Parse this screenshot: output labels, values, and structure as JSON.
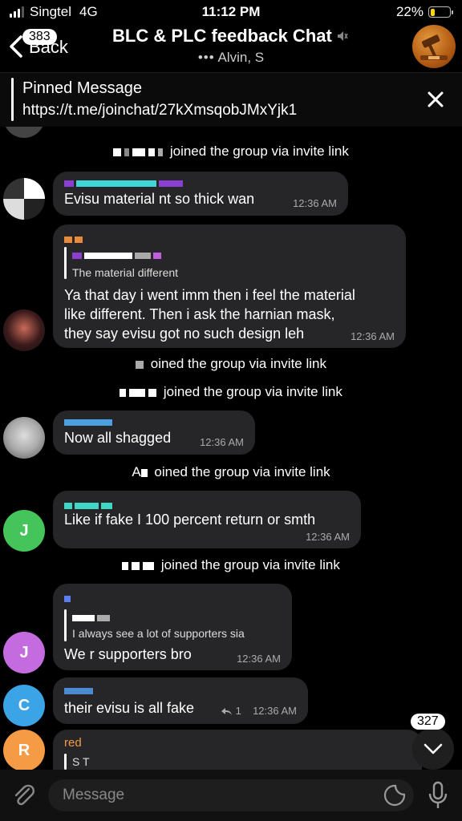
{
  "status_bar": {
    "carrier": "Singtel",
    "network": "4G",
    "time": "11:12 PM",
    "battery_percent": "22%",
    "battery_level": 0.22
  },
  "header": {
    "back_label": "Back",
    "back_count": "383",
    "title": "BLC & PLC feedback Chat",
    "subtitle": "Alvin, S",
    "muted": true
  },
  "pinned": {
    "title": "Pinned Message",
    "link": "https://t.me/joinchat/27kXmsqobJMxYjk1"
  },
  "messages": {
    "service1": "joined the group via invite link",
    "m1": {
      "text": "Evisu material nt so thick wan",
      "time": "12:36 AM"
    },
    "m2": {
      "quote": "The material different",
      "text1": "Ya that day i went imm then i feel the material",
      "text2": "like different. Then i ask the harnian mask,",
      "text3": "they say evisu got no such design leh",
      "time": "12:36 AM"
    },
    "service2": "oined the group via invite link",
    "service3": "joined the group via invite link",
    "m3": {
      "text": "Now all shagged",
      "time": "12:36 AM"
    },
    "service4_prefix": "A",
    "service4": "oined the group via invite link",
    "m4": {
      "text": "Like if fake I 100 percent return or smth",
      "time": "12:36 AM",
      "avatar_letter": "J",
      "avatar_color": "#45c45a"
    },
    "service5": "joined the group via invite link",
    "m5": {
      "quote": "I always see a lot of supporters sia",
      "text": "We r supporters bro",
      "time": "12:36 AM",
      "avatar_letter": "J",
      "avatar_color": "#c56be0"
    },
    "m6": {
      "text": "their evisu is all fake",
      "replies": "1",
      "time": "12:36 AM",
      "avatar_letter": "C",
      "avatar_color": "#3aa4e6"
    },
    "m7": {
      "name": "red",
      "quote": "S T",
      "avatar_letter": "R",
      "avatar_color": "#f59a45"
    }
  },
  "scroll": {
    "unread": "327"
  },
  "composer": {
    "placeholder": "Message"
  },
  "icons": {
    "back": "chevron-left-icon",
    "mute": "mute-icon",
    "close": "close-icon",
    "attach": "paperclip-icon",
    "sticker": "sticker-icon",
    "mic": "microphone-icon",
    "scroll": "chevron-down-icon"
  }
}
